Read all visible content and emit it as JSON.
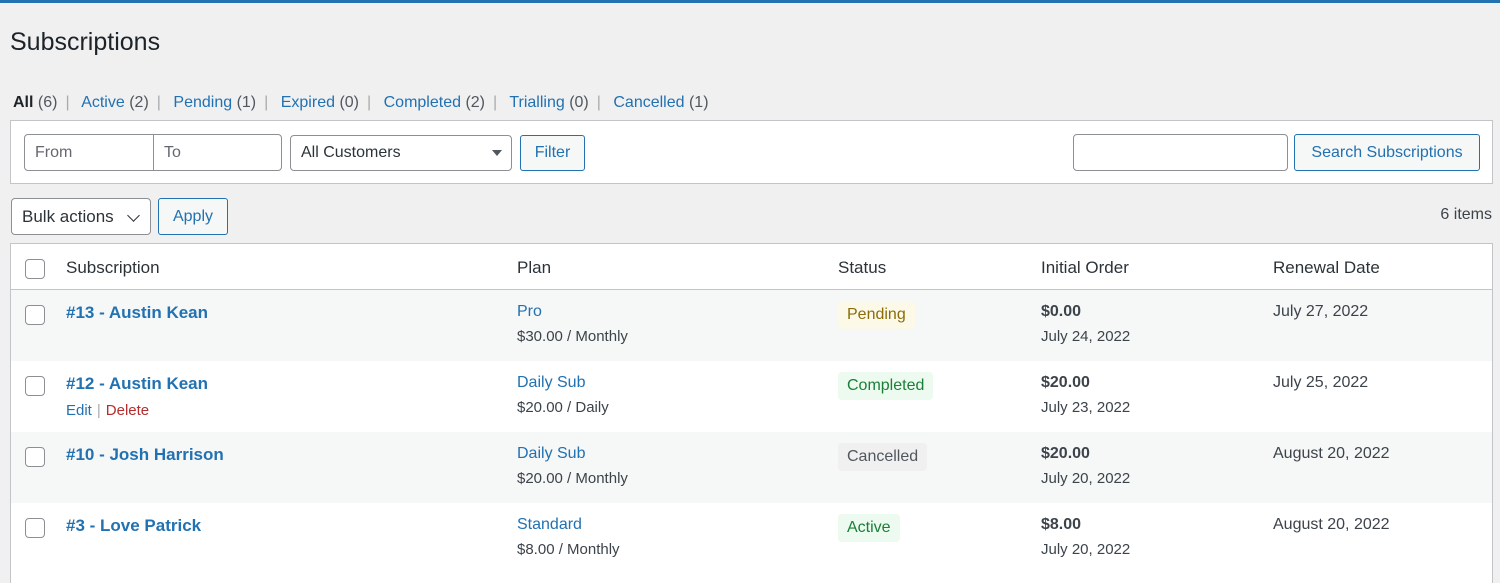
{
  "page": {
    "title": "Subscriptions"
  },
  "status_tabs": [
    {
      "label": "All",
      "count": "(6)"
    },
    {
      "label": "Active",
      "count": "(2)"
    },
    {
      "label": "Pending",
      "count": "(1)"
    },
    {
      "label": "Expired",
      "count": "(0)"
    },
    {
      "label": "Completed",
      "count": "(2)"
    },
    {
      "label": "Trialling",
      "count": "(0)"
    },
    {
      "label": "Cancelled",
      "count": "(1)"
    }
  ],
  "filters": {
    "from_placeholder": "From",
    "to_placeholder": "To",
    "customer_select": "All Customers",
    "filter_label": "Filter",
    "search_value": "",
    "search_label": "Search Subscriptions"
  },
  "bulk": {
    "select_label": "Bulk actions",
    "apply_label": "Apply",
    "items_count": "6 items"
  },
  "table": {
    "columns": [
      "Subscription",
      "Plan",
      "Status",
      "Initial Order",
      "Renewal Date"
    ],
    "rows": [
      {
        "title": "#13 - Austin Kean",
        "plan": "Pro",
        "price": "$30.00 / Monthly",
        "status": "Pending",
        "amount": "$0.00",
        "order_date": "July 24, 2022",
        "renewal": "July 27, 2022"
      },
      {
        "title": "#12 - Austin Kean",
        "edit": "Edit",
        "delete": "Delete",
        "plan": "Daily Sub",
        "price": "$20.00 / Daily",
        "status": "Completed",
        "amount": "$20.00",
        "order_date": "July 23, 2022",
        "renewal": "July 25, 2022"
      },
      {
        "title": "#10 - Josh Harrison",
        "plan": "Daily Sub",
        "price": "$20.00 / Monthly",
        "status": "Cancelled",
        "amount": "$20.00",
        "order_date": "July 20, 2022",
        "renewal": "August 20, 2022"
      },
      {
        "title": "#3 - Love Patrick",
        "plan": "Standard",
        "price": "$8.00 / Monthly",
        "status": "Active",
        "amount": "$8.00",
        "order_date": "July 20, 2022",
        "renewal": "August 20, 2022"
      }
    ]
  },
  "colors": {
    "accent": "#2271b1",
    "delete": "#b32d2e",
    "pending_badge": "#fcf9e8",
    "success_badge": "#edfaef",
    "cancelled_badge": "#f0f0f1"
  }
}
